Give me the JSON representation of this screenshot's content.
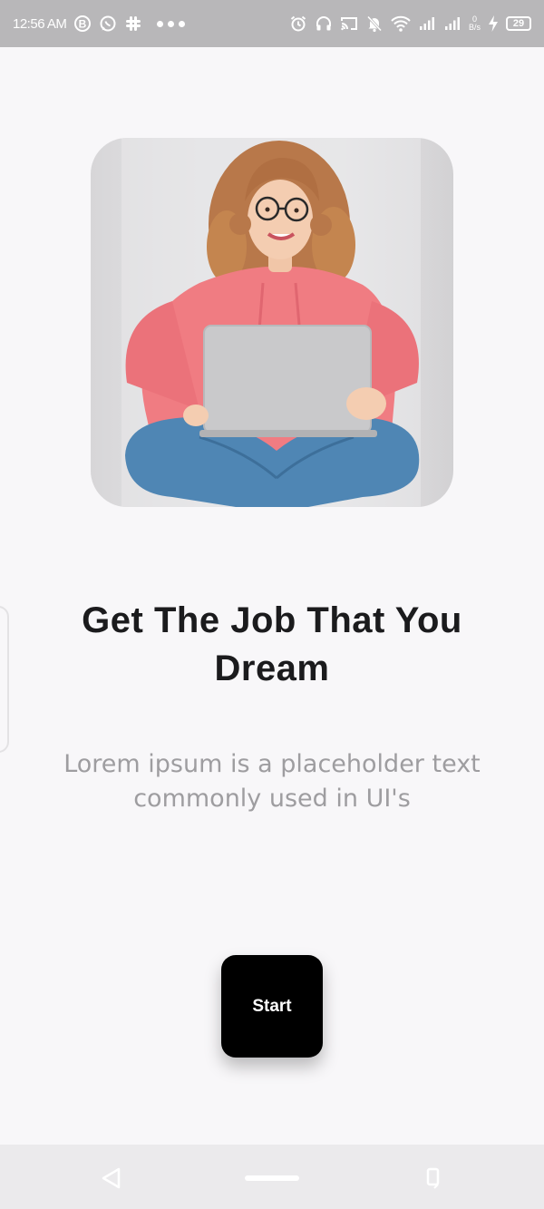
{
  "status_bar": {
    "time": "12:56 AM",
    "network_speed_value": "0",
    "network_speed_unit": "B/s",
    "battery_level": "29",
    "left_icons": [
      "b-circle-icon",
      "whatsapp-icon",
      "slack-icon",
      "more-dots-icon"
    ],
    "right_icons": [
      "alarm-icon",
      "headphones-icon",
      "cast-icon",
      "mute-bell-icon",
      "wifi-icon",
      "signal-icon",
      "signal-icon",
      "network-speed",
      "charging-icon",
      "battery-icon"
    ]
  },
  "hero": {
    "image_subject": "woman-with-laptop"
  },
  "content": {
    "headline": "Get The Job That You Dream",
    "subtext": "Lorem ipsum is a placeholder text commonly used in UI's"
  },
  "actions": {
    "start_label": "Start"
  },
  "nav_bar": {
    "icons": [
      "back-icon",
      "home-pill",
      "recent-apps-icon"
    ]
  },
  "colors": {
    "status_bar_bg": "#b8b7b9",
    "page_bg": "#f8f7f9",
    "headline": "#1b1b1d",
    "subtext": "#9e9da0",
    "button_bg": "#000000",
    "button_text": "#ffffff",
    "hoodie": "#f07c82",
    "jeans": "#4f86b4"
  }
}
